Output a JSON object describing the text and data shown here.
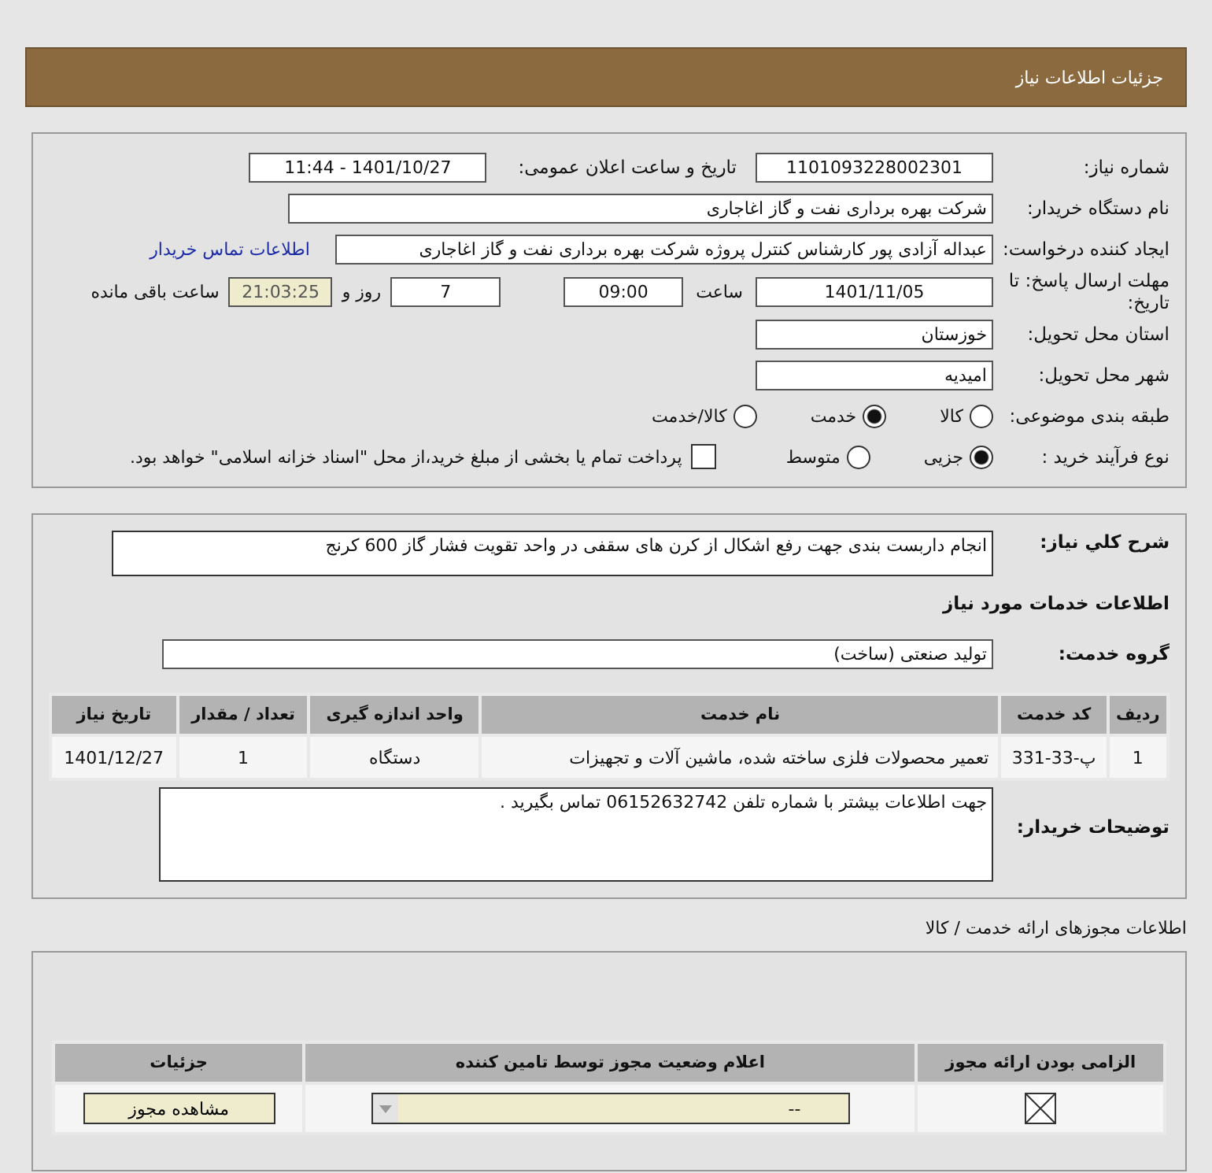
{
  "header": {
    "title": "جزئیات اطلاعات نیاز"
  },
  "details": {
    "need_number": {
      "label": "شماره نیاز:",
      "value": "1101093228002301"
    },
    "announce": {
      "label": "تاریخ و ساعت اعلان عمومی:",
      "value": "1401/10/27 - 11:44"
    },
    "buyer": {
      "label": "نام دستگاه خریدار:",
      "value": "شرکت بهره برداری نفت و گاز اغاجاری"
    },
    "creator": {
      "label": "ایجاد کننده درخواست:",
      "value": "عبداله آزادی پور کارشناس کنترل پروژه شرکت بهره برداری نفت و گاز اغاجاری",
      "link": "اطلاعات تماس خریدار"
    },
    "deadline": {
      "label": "مهلت ارسال پاسخ: تا تاریخ:",
      "date": "1401/11/05",
      "time_label": "ساعت",
      "time": "09:00",
      "days": "7",
      "days_label": "روز و",
      "remaining": "21:03:25",
      "remaining_label": "ساعت باقی مانده"
    },
    "province": {
      "label": "استان محل تحویل:",
      "value": "خوزستان"
    },
    "city": {
      "label": "شهر محل تحویل:",
      "value": "امیدیه"
    },
    "category": {
      "label": "طبقه بندی موضوعی:",
      "options": [
        {
          "label": "کالا",
          "selected": false
        },
        {
          "label": "خدمت",
          "selected": true
        },
        {
          "label": "کالا/خدمت",
          "selected": false
        }
      ]
    },
    "process": {
      "label": "نوع فرآیند خرید :",
      "options": [
        {
          "label": "جزیی",
          "selected": true
        },
        {
          "label": "متوسط",
          "selected": false
        }
      ],
      "treasury": {
        "checked": false,
        "text": "پرداخت تمام یا بخشی از مبلغ خرید،از محل \"اسناد خزانه اسلامی\" خواهد بود."
      }
    }
  },
  "need": {
    "summary_label": "شرح کلي نياز:",
    "summary": "انجام داربست بندی جهت رفع اشکال از کرن های سقفی در واحد تقویت فشار گاز 600 کرنج",
    "services_heading": "اطلاعات خدمات مورد نیاز",
    "group_label": "گروه خدمت:",
    "group": "تولید صنعتی (ساخت)",
    "table": {
      "columns": [
        "ردیف",
        "کد خدمت",
        "نام خدمت",
        "واحد اندازه گیری",
        "تعداد / مقدار",
        "تاریخ نیاز"
      ],
      "rows": [
        [
          "1",
          "پ-33-331",
          "تعمیر محصولات فلزی ساخته شده، ماشین آلات و تجهیزات",
          "دستگاه",
          "1",
          "1401/12/27"
        ]
      ]
    },
    "notes_label": "توضیحات خریدار:",
    "notes": "جهت اطلاعات بیشتر با شماره تلفن 06152632742 تماس بگیرید ."
  },
  "permits": {
    "title": "اطلاعات مجوزهای ارائه خدمت / کالا",
    "columns": [
      "الزامی بودن ارائه مجوز",
      "اعلام وضعیت مجوز توسط تامین کننده",
      "جزئیات"
    ],
    "rows": [
      {
        "required": false,
        "status": "--",
        "button": "مشاهده مجوز"
      }
    ]
  }
}
